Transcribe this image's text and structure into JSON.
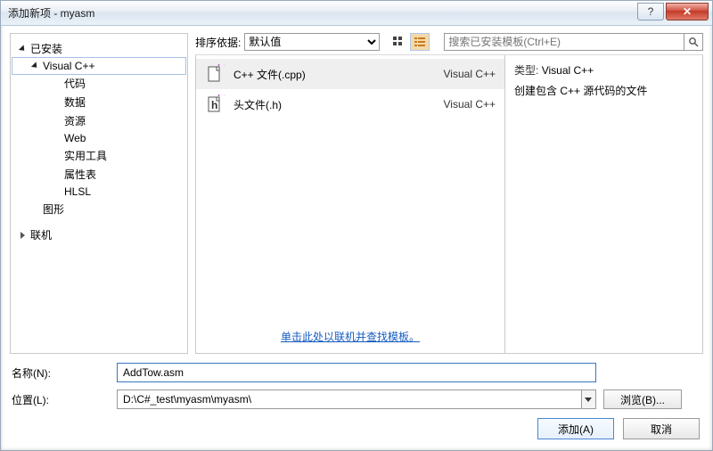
{
  "window": {
    "title": "添加新项 - myasm"
  },
  "winControls": {
    "helpGlyph": "?",
    "closeGlyph": "✕"
  },
  "tree": {
    "installed": "已安装",
    "visualCpp": "Visual C++",
    "children": [
      "代码",
      "数据",
      "资源",
      "Web",
      "实用工具",
      "属性表",
      "HLSL"
    ],
    "graphics": "图形",
    "online": "联机"
  },
  "toolbar": {
    "sortLabel": "排序依据:",
    "sortValue": "默认值",
    "searchPlaceholder": "搜索已安装模板(Ctrl+E)"
  },
  "templates": [
    {
      "name": "C++ 文件(.cpp)",
      "lang": "Visual C++",
      "icon": "cpp"
    },
    {
      "name": "头文件(.h)",
      "lang": "Visual C++",
      "icon": "h"
    }
  ],
  "onlineLink": "单击此处以联机并查找模板。",
  "info": {
    "typeLabel": "类型:",
    "typeValue": "Visual C++",
    "desc": "创建包含 C++ 源代码的文件"
  },
  "form": {
    "nameLabel": "名称(N):",
    "nameValue": "AddTow.asm",
    "locLabel": "位置(L):",
    "locValue": "D:\\C#_test\\myasm\\myasm\\",
    "browse": "浏览(B)..."
  },
  "footer": {
    "add": "添加(A)",
    "cancel": "取消"
  }
}
